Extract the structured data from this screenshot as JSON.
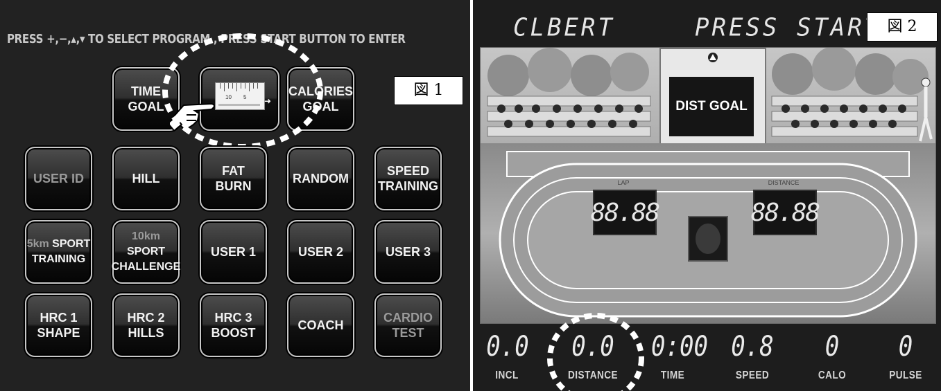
{
  "figure1": {
    "label": "図 1",
    "instruction": "PRESS +,−,▴,▾ TO SELECT PROGRAM , PRESS START BUTTON TO ENTER",
    "buttons": [
      {
        "id": "time-goal",
        "l1": "TIME",
        "l2": "GOAL"
      },
      {
        "id": "calories-goal",
        "l1": "CALORIES",
        "l2": "GOAL"
      },
      {
        "id": "user-id",
        "l1": "USER ID",
        "l2": ""
      },
      {
        "id": "hill",
        "l1": "HILL",
        "l2": ""
      },
      {
        "id": "fat-burn",
        "l1": "FAT",
        "l2": "BURN"
      },
      {
        "id": "random",
        "l1": "RANDOM",
        "l2": ""
      },
      {
        "id": "speed-training",
        "l1": "SPEED",
        "l2": "TRAINING"
      },
      {
        "id": "sport-5km",
        "km": "5km",
        "l1": "SPORT",
        "l2": "TRAINING"
      },
      {
        "id": "sport-10km",
        "km": "10km",
        "l1": "SPORT",
        "l2": "CHALLENGE"
      },
      {
        "id": "user-1",
        "l1": "USER 1",
        "l2": ""
      },
      {
        "id": "user-2",
        "l1": "USER 2",
        "l2": ""
      },
      {
        "id": "user-3",
        "l1": "USER 3",
        "l2": ""
      },
      {
        "id": "hrc-1",
        "l1": "HRC 1",
        "l2": "SHAPE"
      },
      {
        "id": "hrc-2",
        "l1": "HRC 2",
        "l2": "HILLS"
      },
      {
        "id": "hrc-3",
        "l1": "HRC 3",
        "l2": "BOOST"
      },
      {
        "id": "coach",
        "l1": "COACH",
        "l2": ""
      },
      {
        "id": "cardio-test",
        "l1": "CARDIO",
        "l2": "TEST"
      }
    ],
    "ruler_numbers": [
      "10",
      "5"
    ],
    "ruler_arrow": "➜"
  },
  "figure2": {
    "label": "図 2",
    "user_name": "CLBERT",
    "status": "PRESS START",
    "goal_banner": "DIST GOAL",
    "lap_label": "LAP",
    "lap_value": "88.88",
    "distance_label": "DISTANCE",
    "distance_value": "88.88",
    "readouts": [
      {
        "value": "0.0",
        "label": "INCL"
      },
      {
        "value": "0.0",
        "label": "DISTANCE"
      },
      {
        "value": "0:00",
        "label": "TIME"
      },
      {
        "value": "0.8",
        "label": "SPEED"
      },
      {
        "value": "0",
        "label": "CALO"
      },
      {
        "value": "0",
        "label": "PULSE"
      }
    ]
  },
  "colors": {
    "panel_bg": "#222222",
    "button_border": "#c8c8c8",
    "lcd_text": "#e6e6e6"
  }
}
